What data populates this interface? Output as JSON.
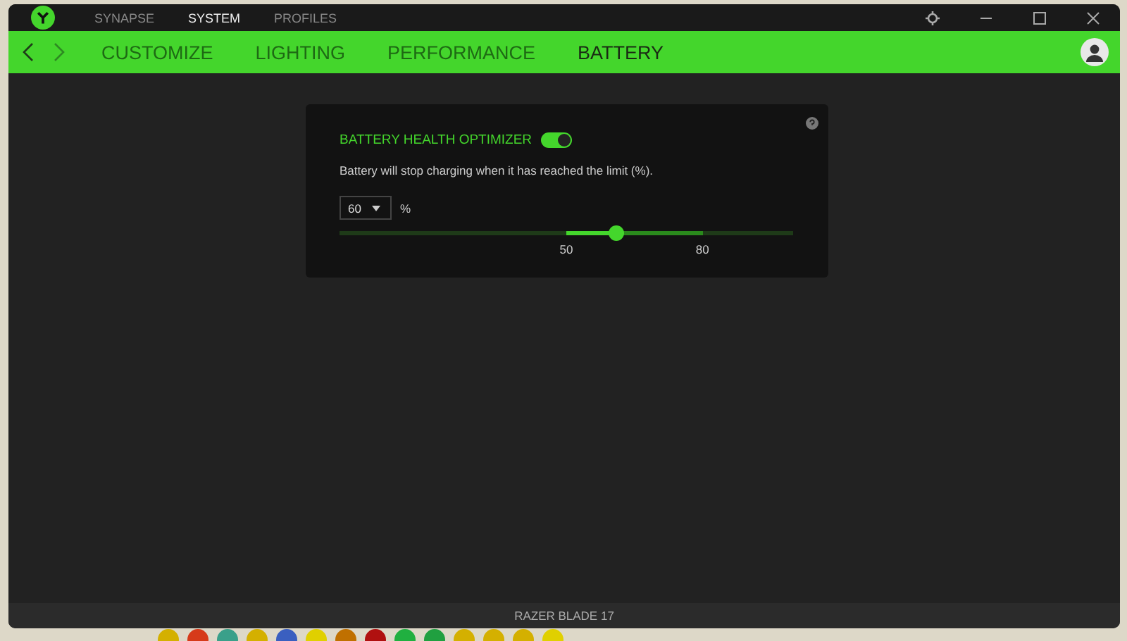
{
  "top_tabs": [
    {
      "label": "SYNAPSE",
      "selected": false
    },
    {
      "label": "SYSTEM",
      "selected": true
    },
    {
      "label": "PROFILES",
      "selected": false
    }
  ],
  "sub_tabs": [
    {
      "label": "CUSTOMIZE",
      "selected": false
    },
    {
      "label": "LIGHTING",
      "selected": false
    },
    {
      "label": "PERFORMANCE",
      "selected": false
    },
    {
      "label": "BATTERY",
      "selected": true
    }
  ],
  "card": {
    "title": "BATTERY HEALTH OPTIMIZER",
    "on": true,
    "description": "Battery will stop charging when it has reached the limit (%).",
    "limit": "60",
    "unit": "%",
    "slider": {
      "level": 0.61,
      "range_labels": [
        "50",
        "80"
      ]
    }
  },
  "status_bar": "RAZER BLADE 17"
}
